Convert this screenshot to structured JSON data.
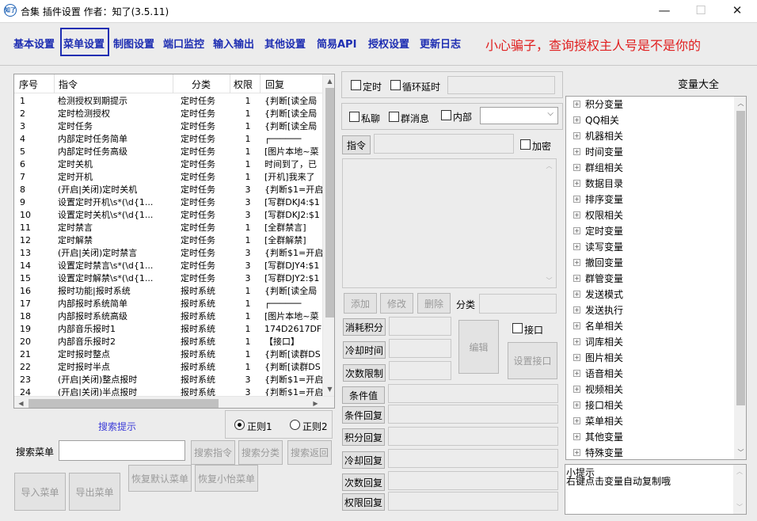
{
  "window": {
    "title": "合集 插件设置  作者：知了(3.5.11)",
    "icon_text": "知了",
    "minimize_glyph": "—",
    "maximize_glyph": "☐",
    "close_glyph": "✕"
  },
  "tabs": [
    "基本设置",
    "菜单设置",
    "制图设置",
    "端口监控",
    "输入输出",
    "其他设置",
    "简易API",
    "授权设置",
    "更新日志"
  ],
  "active_tab": "菜单设置",
  "warning": "小心骗子，查询授权主人号是不是你的",
  "table": {
    "headers": [
      "序号",
      "指令",
      "分类",
      "权限",
      "回复"
    ],
    "rows": [
      [
        "1",
        "检测授权到期提示",
        "定时任务",
        "1",
        "{判断[读全局"
      ],
      [
        "2",
        "定时检测授权",
        "定时任务",
        "1",
        "{判断[读全局"
      ],
      [
        "3",
        "定时任务",
        "定时任务",
        "1",
        "{判断[读全局"
      ],
      [
        "4",
        "内部定时任务简单",
        "定时任务",
        "1",
        "┌──────"
      ],
      [
        "5",
        "内部定时任务高级",
        "定时任务",
        "1",
        "[图片本地~菜"
      ],
      [
        "6",
        "定时关机",
        "定时任务",
        "1",
        "时间到了，已"
      ],
      [
        "7",
        "定时开机",
        "定时任务",
        "1",
        "[开机]我来了"
      ],
      [
        "8",
        "(开启|关闭)定时关机",
        "定时任务",
        "3",
        "{判断$1=开启"
      ],
      [
        "9",
        "设置定时开机\\s*(\\d{1...",
        "定时任务",
        "3",
        "[写群DKJ4:$1"
      ],
      [
        "10",
        "设置定时关机\\s*(\\d{1...",
        "定时任务",
        "3",
        "[写群DKJ2:$1"
      ],
      [
        "11",
        "定时禁言",
        "定时任务",
        "1",
        "[全群禁言]"
      ],
      [
        "12",
        "定时解禁",
        "定时任务",
        "1",
        "[全群解禁]"
      ],
      [
        "13",
        "(开启|关闭)定时禁言",
        "定时任务",
        "3",
        "{判断$1=开启"
      ],
      [
        "14",
        "设置定时禁言\\s*(\\d{1...",
        "定时任务",
        "3",
        "[写群DJY4:$1"
      ],
      [
        "15",
        "设置定时解禁\\s*(\\d{1...",
        "定时任务",
        "3",
        "[写群DJY2:$1"
      ],
      [
        "16",
        "报时功能|报时系统",
        "报时系统",
        "1",
        "{判断[读全局"
      ],
      [
        "17",
        "内部报时系统简单",
        "报时系统",
        "1",
        "┌──────"
      ],
      [
        "18",
        "内部报时系统高级",
        "报时系统",
        "1",
        "[图片本地~菜"
      ],
      [
        "19",
        "内部音乐报时1",
        "报时系统",
        "1",
        "174D2617DFEA"
      ],
      [
        "20",
        "内部音乐报时2",
        "报时系统",
        "1",
        "【接口】"
      ],
      [
        "21",
        "定时报时整点",
        "报时系统",
        "1",
        "{判断[读群DS"
      ],
      [
        "22",
        "定时报时半点",
        "报时系统",
        "1",
        "{判断[读群DS"
      ],
      [
        "23",
        "(开启|关闭)整点报时",
        "报时系统",
        "3",
        "{判断$1=开启"
      ],
      [
        "24",
        "(开启|关闭)半点报时",
        "报时系统",
        "3",
        "{判断$1=开启"
      ]
    ]
  },
  "search": {
    "hint": "搜索提示",
    "regex1": "正则1",
    "regex2": "正则2",
    "regex_selected": "正则1",
    "label": "搜索菜单",
    "value": "",
    "btn_cmd": "搜索指令",
    "btn_cat": "搜索分类",
    "btn_back": "搜索返回"
  },
  "bottom_buttons": {
    "import": "导入菜单",
    "export": "导出菜单",
    "restore_default": "恢复默认菜单",
    "restore_xiaoyi": "恢复小怡菜单"
  },
  "editor": {
    "timer": "定时",
    "loop_delay": "循环延时",
    "private": "私聊",
    "group_msg": "群消息",
    "internal": "内部",
    "command_btn": "指令",
    "encrypt": "加密",
    "add": "添加",
    "modify": "修改",
    "delete": "删除",
    "category": "分类",
    "consume_points": "消耗积分",
    "cooldown": "冷却时间",
    "count_limit": "次数限制",
    "edit": "编辑",
    "api": "接口",
    "set_api": "设置接口",
    "cond_value": "条件值",
    "cond_reply": "条件回复",
    "points_reply": "积分回复",
    "cooldown_reply": "冷却回复",
    "count_reply": "次数回复",
    "perm_reply": "权限回复"
  },
  "variables": {
    "title": "变量大全",
    "items": [
      "积分变量",
      "QQ相关",
      "机器相关",
      "时间变量",
      "群组相关",
      "数据目录",
      "排序变量",
      "权限相关",
      "定时变量",
      "读写变量",
      "撤回变量",
      "群管变量",
      "发送模式",
      "发送执行",
      "名单相关",
      "词库相关",
      "图片相关",
      "语音相关",
      "视频相关",
      "接口相关",
      "菜单相关",
      "其他变量",
      "特殊变量"
    ],
    "tip_title": "小提示",
    "tip_text": "右键点击变量自动复制哦"
  }
}
